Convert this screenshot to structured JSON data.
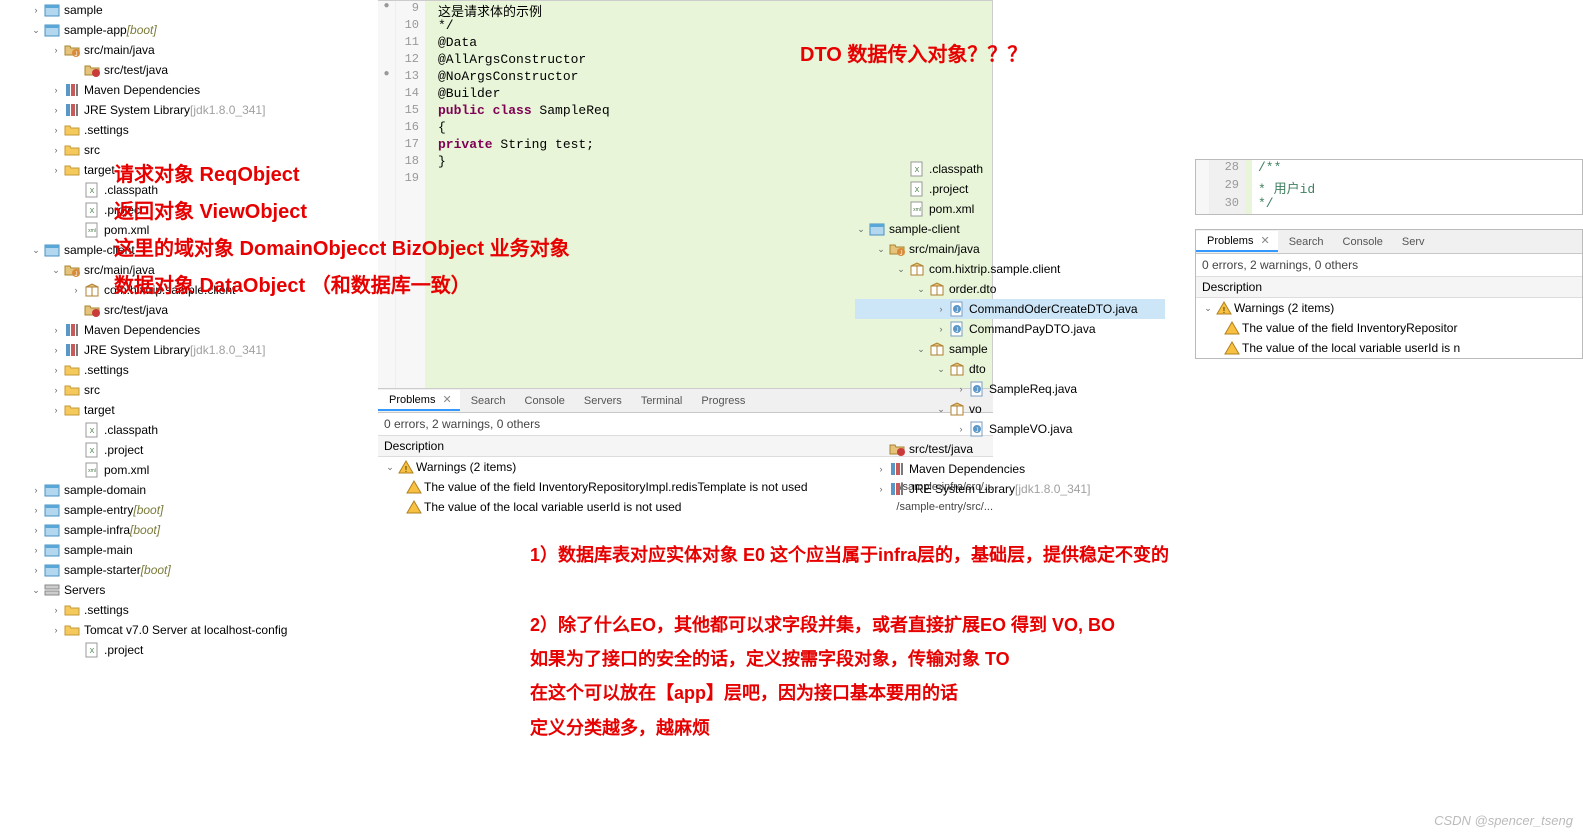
{
  "leftTree": [
    {
      "pad": 20,
      "tw": ">",
      "icon": "proj",
      "label": "sample"
    },
    {
      "pad": 20,
      "tw": "v",
      "icon": "proj",
      "label": "sample-app",
      "suffix": "[boot]",
      "suffixCls": "boot"
    },
    {
      "pad": 40,
      "tw": ">",
      "icon": "srcfolder-j",
      "label": "src/main/java"
    },
    {
      "pad": 60,
      "tw": "",
      "icon": "srcfolder-test",
      "label": "src/test/java"
    },
    {
      "pad": 40,
      "tw": ">",
      "icon": "lib",
      "label": "Maven Dependencies"
    },
    {
      "pad": 40,
      "tw": ">",
      "icon": "lib",
      "label": "JRE System Library",
      "suffix": "[jdk1.8.0_341]",
      "suffixCls": "lib-ver"
    },
    {
      "pad": 40,
      "tw": ">",
      "icon": "folder",
      "label": ".settings"
    },
    {
      "pad": 40,
      "tw": ">",
      "icon": "folder",
      "label": "src"
    },
    {
      "pad": 40,
      "tw": ">",
      "icon": "folder",
      "label": "target"
    },
    {
      "pad": 60,
      "tw": "",
      "icon": "xfile",
      "label": ".classpath"
    },
    {
      "pad": 60,
      "tw": "",
      "icon": "xfile",
      "label": ".project"
    },
    {
      "pad": 60,
      "tw": "",
      "icon": "xml",
      "label": "pom.xml"
    },
    {
      "pad": 20,
      "tw": "v",
      "icon": "proj",
      "label": "sample-client"
    },
    {
      "pad": 40,
      "tw": "v",
      "icon": "srcfolder-j",
      "label": "src/main/java"
    },
    {
      "pad": 60,
      "tw": ">",
      "icon": "pkg",
      "label": "com.hixtrip.sample.client"
    },
    {
      "pad": 60,
      "tw": "",
      "icon": "srcfolder-test",
      "label": "src/test/java"
    },
    {
      "pad": 40,
      "tw": ">",
      "icon": "lib",
      "label": "Maven Dependencies"
    },
    {
      "pad": 40,
      "tw": ">",
      "icon": "lib",
      "label": "JRE System Library",
      "suffix": "[jdk1.8.0_341]",
      "suffixCls": "lib-ver"
    },
    {
      "pad": 40,
      "tw": ">",
      "icon": "folder",
      "label": ".settings"
    },
    {
      "pad": 40,
      "tw": ">",
      "icon": "folder",
      "label": "src"
    },
    {
      "pad": 40,
      "tw": ">",
      "icon": "folder",
      "label": "target"
    },
    {
      "pad": 60,
      "tw": "",
      "icon": "xfile",
      "label": ".classpath"
    },
    {
      "pad": 60,
      "tw": "",
      "icon": "xfile",
      "label": ".project"
    },
    {
      "pad": 60,
      "tw": "",
      "icon": "xml",
      "label": "pom.xml"
    },
    {
      "pad": 20,
      "tw": ">",
      "icon": "proj",
      "label": "sample-domain"
    },
    {
      "pad": 20,
      "tw": ">",
      "icon": "proj",
      "label": "sample-entry",
      "suffix": "[boot]",
      "suffixCls": "boot"
    },
    {
      "pad": 20,
      "tw": ">",
      "icon": "proj",
      "label": "sample-infra",
      "suffix": "[boot]",
      "suffixCls": "boot"
    },
    {
      "pad": 20,
      "tw": ">",
      "icon": "proj",
      "label": "sample-main"
    },
    {
      "pad": 20,
      "tw": ">",
      "icon": "proj",
      "label": "sample-starter",
      "suffix": "[boot]",
      "suffixCls": "boot"
    },
    {
      "pad": 20,
      "tw": "v",
      "icon": "servers",
      "label": "Servers"
    },
    {
      "pad": 40,
      "tw": ">",
      "icon": "folder",
      "label": ".settings"
    },
    {
      "pad": 40,
      "tw": ">",
      "icon": "folder",
      "label": "Tomcat v7.0 Server at localhost-config"
    },
    {
      "pad": 60,
      "tw": "",
      "icon": "xfile",
      "label": ".project"
    }
  ],
  "editor": {
    "lines": [
      {
        "n": 9,
        "gut": "marker",
        "code": "     这是请求体的示例",
        "cls": "comment"
      },
      {
        "n": 10,
        "gut": "",
        "code": " */",
        "cls": "comment"
      },
      {
        "n": 11,
        "gut": "",
        "code": "@Data",
        "cls": "ann"
      },
      {
        "n": 12,
        "gut": "",
        "code": "@AllArgsConstructor",
        "cls": "ann"
      },
      {
        "n": 13,
        "gut": "marker",
        "code": "@NoArgsConstructor",
        "cls": "ann"
      },
      {
        "n": 14,
        "gut": "",
        "code": "@Builder",
        "cls": "ann"
      },
      {
        "n": 15,
        "gut": "",
        "code": "<span class='kw'>public class</span> SampleReq"
      },
      {
        "n": 16,
        "gut": "",
        "code": "{"
      },
      {
        "n": 17,
        "gut": "",
        "code": "    <span class='kw'>private</span> String test;"
      },
      {
        "n": 18,
        "gut": "",
        "code": "}"
      },
      {
        "n": 19,
        "gut": "",
        "code": ""
      }
    ]
  },
  "problems": {
    "tabs": [
      {
        "icon": "prob",
        "label": "Problems",
        "active": true
      },
      {
        "icon": "search",
        "label": "Search"
      },
      {
        "icon": "console",
        "label": "Console"
      },
      {
        "icon": "servers",
        "label": "Servers"
      },
      {
        "icon": "terminal",
        "label": "Terminal"
      },
      {
        "icon": "progress",
        "label": "Progress"
      }
    ],
    "summary": "0 errors, 2 warnings, 0 others",
    "colHead": "Description",
    "groupLabel": "Warnings (2 items)",
    "items": [
      {
        "text": "The value of the field InventoryRepositoryImpl.redisTemplate is not used",
        "path": "/sample-infra/src/..."
      },
      {
        "text": "The value of the local variable userId is not used",
        "path": "/sample-entry/src/..."
      }
    ]
  },
  "midTree": [
    {
      "pad": 0,
      "tw": "",
      "icon": "xfile",
      "label": ".classpath"
    },
    {
      "pad": 0,
      "tw": "",
      "icon": "xfile",
      "label": ".project"
    },
    {
      "pad": 0,
      "tw": "",
      "icon": "xml",
      "label": "pom.xml"
    },
    {
      "pad": -40,
      "tw": "v",
      "icon": "proj",
      "label": "sample-client"
    },
    {
      "pad": -20,
      "tw": "v",
      "icon": "srcfolder-j",
      "label": "src/main/java"
    },
    {
      "pad": 0,
      "tw": "v",
      "icon": "pkg",
      "label": "com.hixtrip.sample.client"
    },
    {
      "pad": 20,
      "tw": "v",
      "icon": "pkg",
      "label": "order.dto"
    },
    {
      "pad": 40,
      "tw": ">",
      "icon": "java",
      "label": "CommandOderCreateDTO.java",
      "sel": true
    },
    {
      "pad": 40,
      "tw": ">",
      "icon": "java",
      "label": "CommandPayDTO.java"
    },
    {
      "pad": 20,
      "tw": "v",
      "icon": "pkg",
      "label": "sample"
    },
    {
      "pad": 40,
      "tw": "v",
      "icon": "pkg",
      "label": "dto"
    },
    {
      "pad": 60,
      "tw": ">",
      "icon": "java",
      "label": "SampleReq.java"
    },
    {
      "pad": 40,
      "tw": "v",
      "icon": "pkg",
      "label": "vo"
    },
    {
      "pad": 60,
      "tw": ">",
      "icon": "java",
      "label": "SampleVO.java"
    },
    {
      "pad": -20,
      "tw": "",
      "icon": "srcfolder-test",
      "label": "src/test/java"
    },
    {
      "pad": -20,
      "tw": ">",
      "icon": "lib",
      "label": "Maven Dependencies"
    },
    {
      "pad": -20,
      "tw": ">",
      "icon": "lib",
      "label": "JRE System Library",
      "suffix": "[jdk1.8.0_341]",
      "suffixCls": "lib-ver"
    }
  ],
  "rightCode": {
    "lines": [
      {
        "n": 28,
        "code": "/**",
        "cls": "comment"
      },
      {
        "n": 29,
        "code": " *  用户id",
        "cls": "comment"
      },
      {
        "n": 30,
        "code": " */",
        "cls": "comment"
      }
    ]
  },
  "rightProblems": {
    "tabs": [
      {
        "icon": "prob",
        "label": "Problems",
        "active": true
      },
      {
        "icon": "search",
        "label": "Search"
      },
      {
        "icon": "console",
        "label": "Console"
      },
      {
        "icon": "servers",
        "label": "Serv"
      }
    ],
    "summary": "0 errors, 2 warnings, 0 others",
    "colHead": "Description",
    "groupLabel": "Warnings (2 items)",
    "items": [
      {
        "text": "The value of the field InventoryRepositor"
      },
      {
        "text": "The value of the local variable userId is n"
      }
    ]
  },
  "annotations": {
    "topRight": "DTO  数据传入对象？？？",
    "leftBlock": [
      "请求对象    ReqObject",
      "返回对象    ViewObject",
      "这里的域对象    DomainObjecct    BizObject  业务对象",
      "数据对象    DataObject   （和数据库一致）"
    ],
    "bottom1": "1）数据库表对应实体对象    E0   这个应当属于infra层的，基础层，提供稳定不变的",
    "bottom2a": "2）除了什么EO，其他都可以求字段并集，或者直接扩展EO 得到 VO, BO",
    "bottom2b": "如果为了接口的安全的话，定义按需字段对象，传输对象 TO",
    "bottom2c": "在这个可以放在【app】层吧，因为接口基本要用的话",
    "bottom2d": "定义分类越多，越麻烦"
  },
  "footer": "CSDN @spencer_tseng"
}
